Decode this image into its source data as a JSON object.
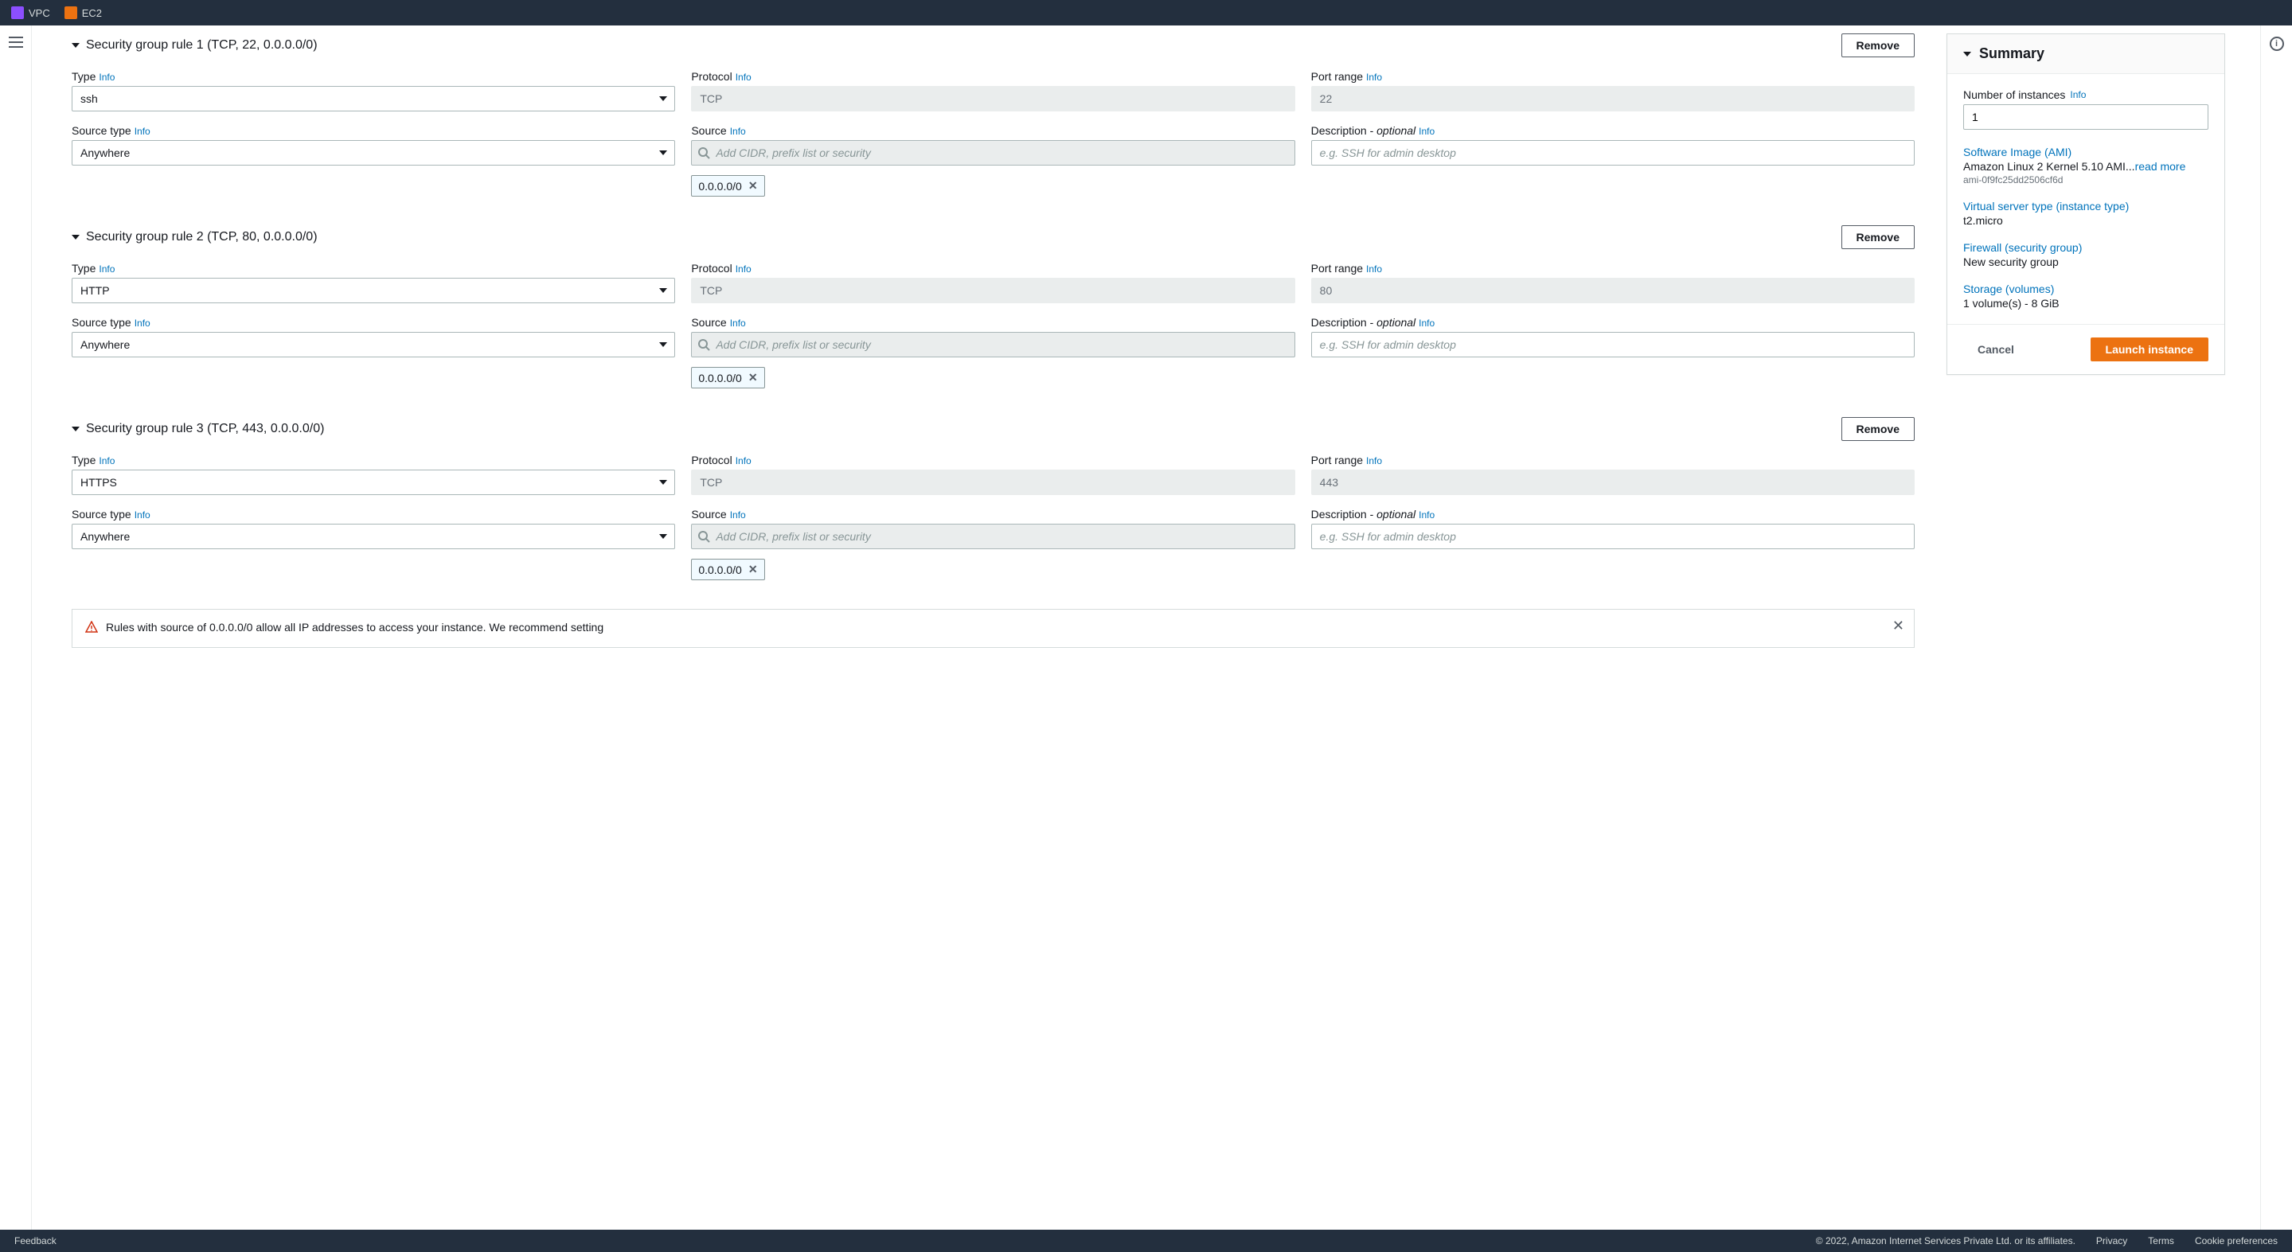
{
  "topNav": {
    "items": [
      {
        "label": "VPC"
      },
      {
        "label": "EC2"
      }
    ]
  },
  "common": {
    "infoLabel": "Info",
    "removeLabel": "Remove",
    "typeLabel": "Type",
    "protocolLabel": "Protocol",
    "portRangeLabel": "Port range",
    "sourceTypeLabel": "Source type",
    "sourceLabel": "Source",
    "descriptionLabel": "Description - ",
    "optionalLabel": "optional",
    "sourcePlaceholder": "Add CIDR, prefix list or security",
    "descPlaceholder": "e.g. SSH for admin desktop"
  },
  "rules": [
    {
      "title": "Security group rule 1 (TCP, 22, 0.0.0.0/0)",
      "type": "ssh",
      "protocol": "TCP",
      "portRange": "22",
      "sourceType": "Anywhere",
      "sourceValue": "",
      "token": "0.0.0.0/0",
      "description": ""
    },
    {
      "title": "Security group rule 2 (TCP, 80, 0.0.0.0/0)",
      "type": "HTTP",
      "protocol": "TCP",
      "portRange": "80",
      "sourceType": "Anywhere",
      "sourceValue": "",
      "token": "0.0.0.0/0",
      "description": ""
    },
    {
      "title": "Security group rule 3 (TCP, 443, 0.0.0.0/0)",
      "type": "HTTPS",
      "protocol": "TCP",
      "portRange": "443",
      "sourceType": "Anywhere",
      "sourceValue": "",
      "token": "0.0.0.0/0",
      "description": ""
    }
  ],
  "warning": {
    "text": "Rules with source of 0.0.0.0/0 allow all IP addresses to access your instance. We recommend setting"
  },
  "summary": {
    "title": "Summary",
    "numInstancesLabel": "Number of instances",
    "numInstances": "1",
    "amiLabel": "Software Image (AMI)",
    "amiName": "Amazon Linux 2 Kernel 5.10 AMI...",
    "readMore": "read more",
    "amiId": "ami-0f9fc25dd2506cf6d",
    "instanceTypeLabel": "Virtual server type (instance type)",
    "instanceType": "t2.micro",
    "firewallLabel": "Firewall (security group)",
    "firewallValue": "New security group",
    "storageLabel": "Storage (volumes)",
    "storageValue": "1 volume(s) - 8 GiB",
    "cancelLabel": "Cancel",
    "launchLabel": "Launch instance"
  },
  "footer": {
    "feedback": "Feedback",
    "copyright": "© 2022, Amazon Internet Services Private Ltd. or its affiliates.",
    "privacy": "Privacy",
    "terms": "Terms",
    "cookies": "Cookie preferences"
  }
}
